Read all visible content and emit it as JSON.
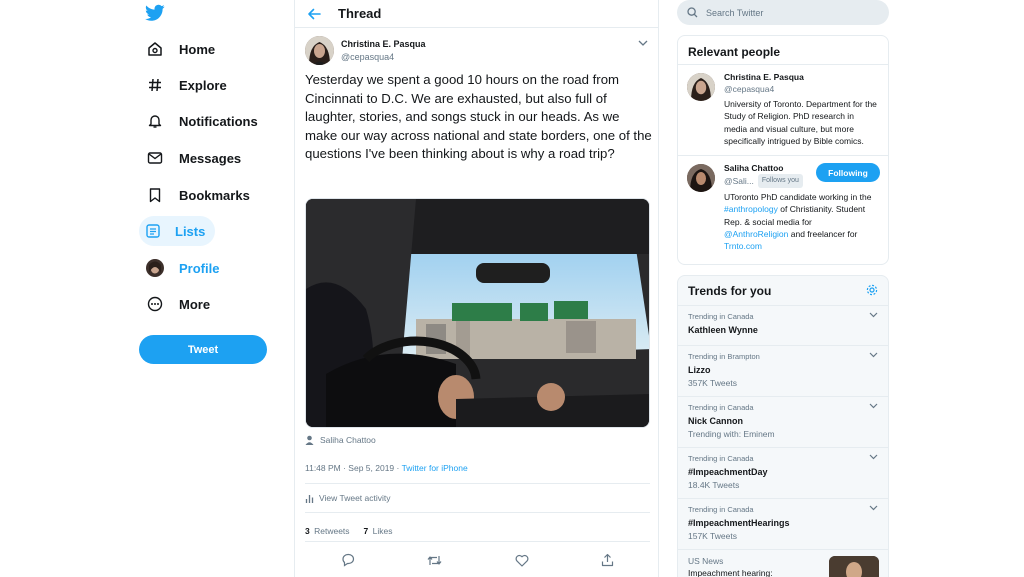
{
  "nav": {
    "items": [
      {
        "label": "Home",
        "icon": "home-icon"
      },
      {
        "label": "Explore",
        "icon": "hashtag-icon"
      },
      {
        "label": "Notifications",
        "icon": "bell-icon"
      },
      {
        "label": "Messages",
        "icon": "envelope-icon"
      },
      {
        "label": "Bookmarks",
        "icon": "bookmark-icon"
      },
      {
        "label": "Lists",
        "icon": "list-icon"
      },
      {
        "label": "Profile",
        "icon": "avatar"
      },
      {
        "label": "More",
        "icon": "more-icon"
      }
    ],
    "tweet_button": "Tweet"
  },
  "thread": {
    "title": "Thread",
    "author_name": "Christina E. Pasqua",
    "author_handle": "@cepasqua4",
    "text": "Yesterday we spent a good 10 hours on the road from Cincinnati to D.C. We are exhausted, but also full of laughter, stories, and songs stuck in our heads. As we make our way across national and state borders, one of the questions I've been thinking about is why a road trip?",
    "tagged_user": "Saliha Chattoo",
    "timestamp": "11:48 PM · Sep 5, 2019 · ",
    "source": "Twitter for iPhone",
    "activity_label": "View Tweet activity",
    "retweets_count": "3",
    "retweets_label": "Retweets",
    "likes_count": "7",
    "likes_label": "Likes"
  },
  "search": {
    "placeholder": "Search Twitter"
  },
  "relevant": {
    "title": "Relevant people",
    "people": [
      {
        "name": "Christina E. Pasqua",
        "handle": "@cepasqua4",
        "bio": "University of Toronto. Department for the Study of Religion. PhD research in media and visual culture, but more specifically intrigued by Bible comics."
      },
      {
        "name": "Saliha Chattoo",
        "handle": "@Sali...",
        "follows_you": "Follows you",
        "button": "Following",
        "bio_1": "UToronto PhD candidate working in the ",
        "bio_link_1": "#anthropology",
        "bio_2": " of Christianity. Student Rep. & social media for ",
        "bio_link_2": "@AnthroReligion",
        "bio_3": " and freelancer for ",
        "bio_link_3": "Trnto.com"
      }
    ]
  },
  "trends": {
    "title": "Trends for you",
    "items": [
      {
        "context": "Trending in Canada",
        "name": "Kathleen Wynne",
        "count": ""
      },
      {
        "context": "Trending in Brampton",
        "name": "Lizzo",
        "count": "357K Tweets"
      },
      {
        "context": "Trending in Canada",
        "name": "Nick Cannon",
        "count": "Trending with: Eminem"
      },
      {
        "context": "Trending in Canada",
        "name": "#ImpeachmentDay",
        "count": "18.4K Tweets"
      },
      {
        "context": "Trending in Canada",
        "name": "#ImpeachmentHearings",
        "count": "157K Tweets"
      }
    ],
    "news": {
      "source": "US News",
      "headline": "Impeachment hearing:"
    }
  },
  "colors": {
    "accent": "#1da1f2",
    "text": "#14171a",
    "muted": "#657786",
    "border": "#e6ecf0"
  }
}
